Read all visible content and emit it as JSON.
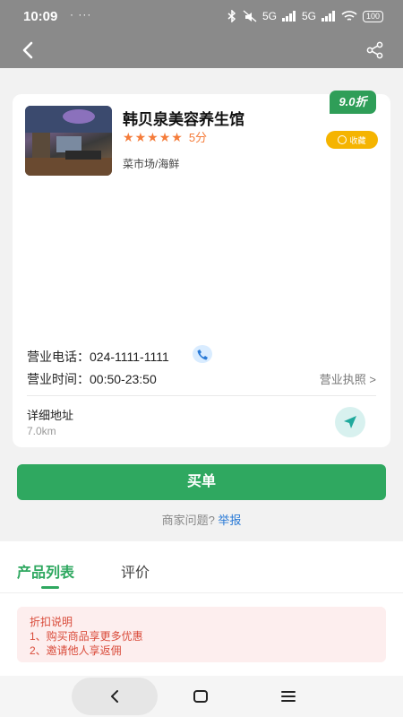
{
  "status_bar": {
    "time": "10:09",
    "dots": "· ···",
    "network_1": "5G",
    "network_2": "5G",
    "battery": "100"
  },
  "header": {
    "back_icon": "chevron-left-icon",
    "share_icon": "share-icon"
  },
  "shop": {
    "name": "韩贝泉美容养生馆",
    "stars_filled": 5,
    "stars_total": 5,
    "score": "5分",
    "category": "菜市场/海鲜",
    "discount": "9.0折",
    "favorite_label": "收藏",
    "phone_label": "营业电话：",
    "phone": "024-1111-1111",
    "hours_label": "营业时间：",
    "hours": "00:50-23:50",
    "license_link": "营业执照 >",
    "address_label": "详细地址",
    "distance": "7.0km"
  },
  "actions": {
    "pay_label": "买单",
    "question_text": "商家问题?",
    "report_link": "举报"
  },
  "tabs": [
    {
      "label": "产品列表",
      "active": true
    },
    {
      "label": "评价",
      "active": false
    }
  ],
  "notice": {
    "title": "折扣说明",
    "line1": "1、购买商品享更多优惠",
    "line2": "2、邀请他人享返佣"
  },
  "colors": {
    "accent_green": "#2fa860",
    "star_orange": "#f57c3a",
    "favorite_yellow": "#f5b400",
    "link_blue": "#2a7ad6",
    "notice_red": "#d94b3a"
  }
}
